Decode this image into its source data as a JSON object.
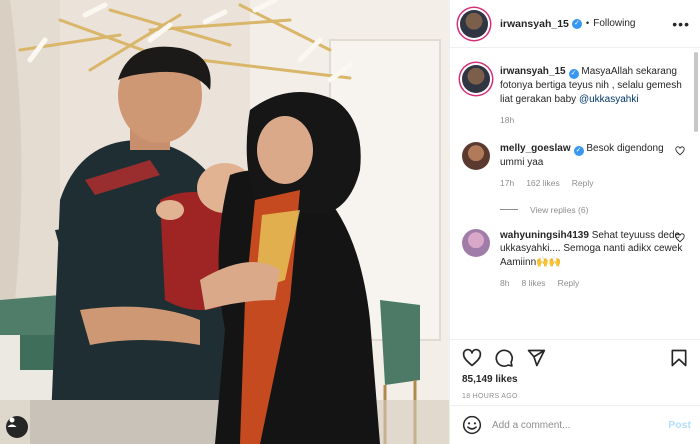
{
  "post": {
    "username": "irwansyah_15",
    "follow_state": "Following",
    "separator": "•",
    "more_label": "•••"
  },
  "caption": {
    "username": "irwansyah_15",
    "text": "MasyaAllah sekarang fotonya bertiga teyus nih , selalu gemesh liat gerakan baby",
    "mention": "@ukkasyahki",
    "time": "18h"
  },
  "comments": [
    {
      "username": "melly_goeslaw",
      "verified": true,
      "text": "Besok digendong ummi yaa",
      "time": "17h",
      "likes": "162 likes",
      "reply": "Reply",
      "view_replies": "View replies (6)"
    },
    {
      "username": "wahyuningsih4139",
      "verified": false,
      "text": "Sehat teyuuss dede ukkasyahki.... Semoga nanti adikx cewek Aamiinn",
      "emoji": "🙌🙌",
      "time": "8h",
      "likes": "8 likes",
      "reply": "Reply"
    }
  ],
  "stats": {
    "likes": "85,149 likes",
    "ago": "18 HOURS AGO"
  },
  "composer": {
    "placeholder": "Add a comment...",
    "post_label": "Post"
  },
  "icons": {
    "verified": "✓",
    "heart": "heart-icon",
    "comment": "comment-icon",
    "share": "share-icon",
    "save": "bookmark-icon",
    "emoji": "emoji-icon",
    "user": "user-icon"
  },
  "colors": {
    "accent_link": "#00376b",
    "verified_blue": "#3897f0",
    "post_disabled": "#b2dffc",
    "muted": "#8e8e8e"
  }
}
